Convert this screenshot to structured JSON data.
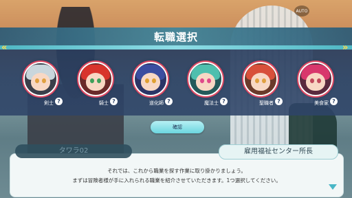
{
  "hud": {
    "auto_label": "AUTO"
  },
  "screen": {
    "title": "転職選択"
  },
  "jobs": [
    {
      "label": "剣士",
      "hair": "#c9d6dc",
      "eye": "#e0a040"
    },
    {
      "label": "騎士",
      "hair": "#d8342c",
      "eye": "#3fa05a"
    },
    {
      "label": "道化師",
      "hair": "#3b4da0",
      "eye": "#e0a030"
    },
    {
      "label": "魔法士",
      "hair": "#4fbfae",
      "eye": "#e04a8a"
    },
    {
      "label": "聖職者",
      "hair": "#d8503a",
      "eye": "#e0a040"
    },
    {
      "label": "美食家",
      "hair": "#d8386c",
      "eye": "#c04a5a"
    }
  ],
  "help_glyph": "?",
  "confirm_label": "確認",
  "dialogue": {
    "left_name": "タワラ02",
    "right_name": "雇用福祉センター所長",
    "line1": "それでは、これから職業を探す作業に取り掛かりましょう。",
    "line2": "まずは冒険者様が手に入れられる職業を紹介させていただきます。1つ選択してください。"
  },
  "colors": {
    "accent": "#ffd84a",
    "panel": "#2e4468",
    "portrait_ring": "#e04a64"
  }
}
